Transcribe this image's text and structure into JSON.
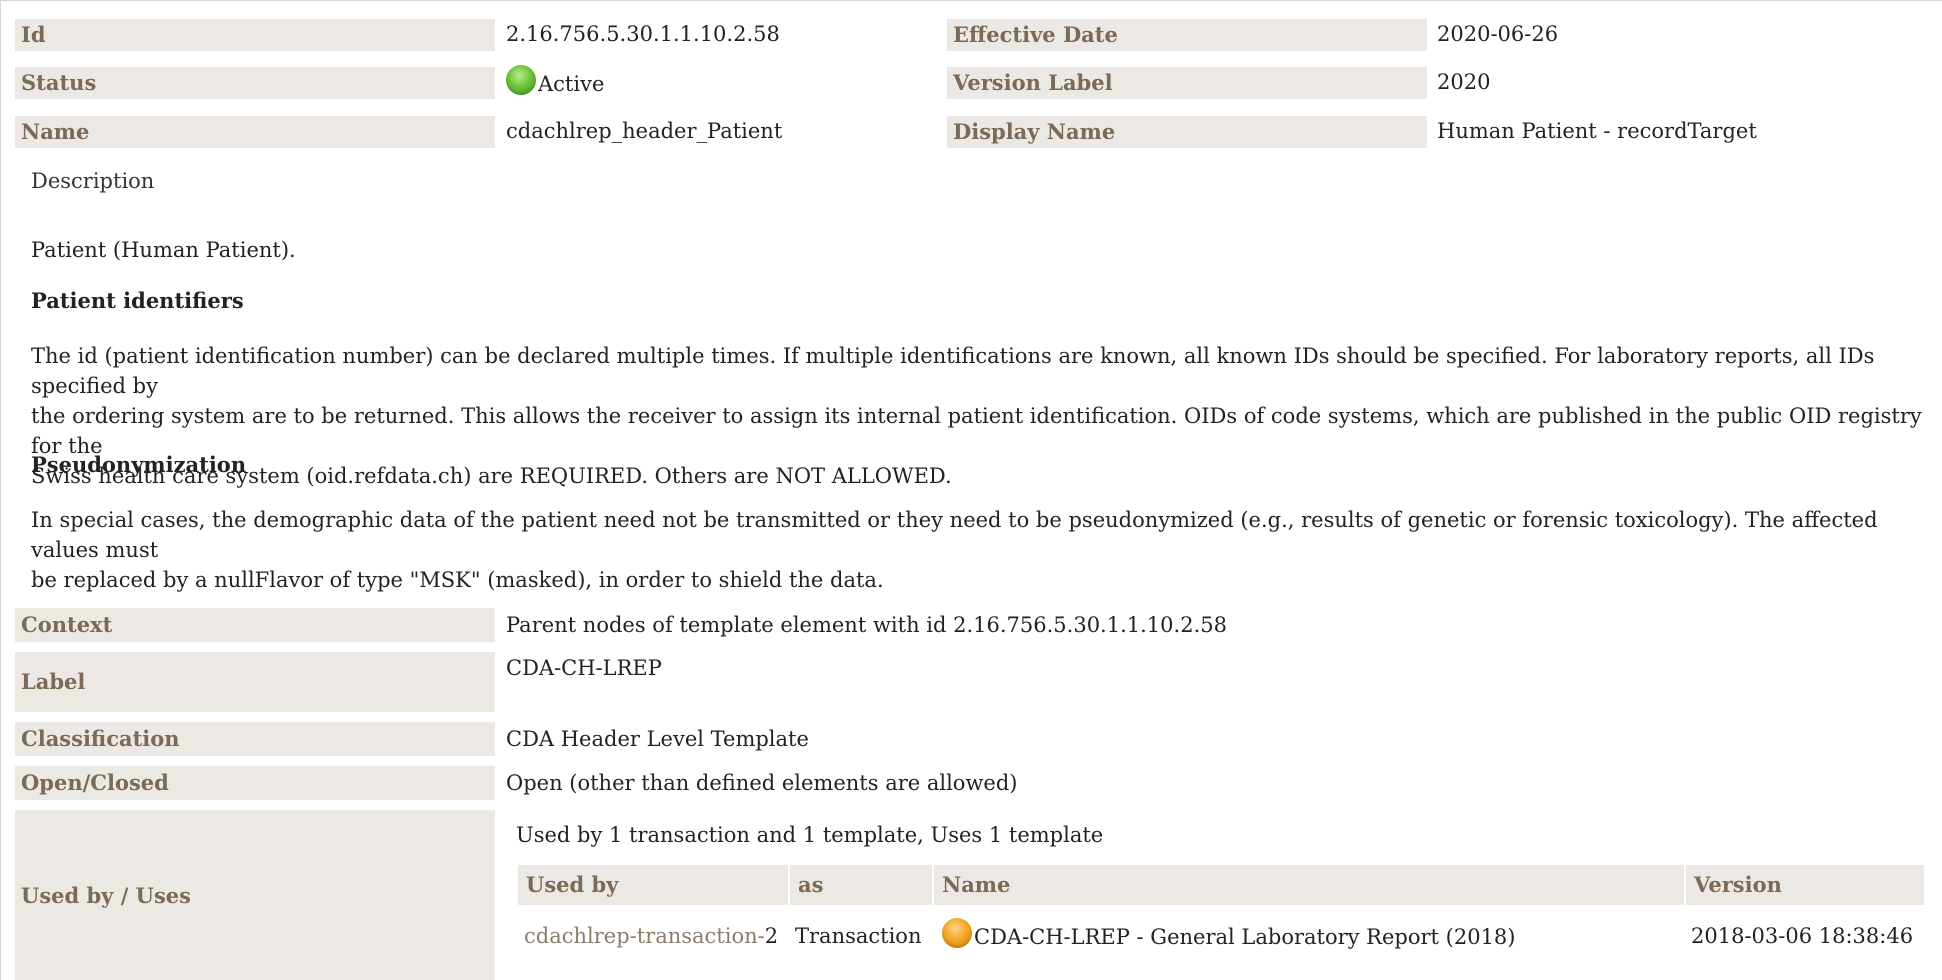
{
  "header": {
    "id_label": "Id",
    "id_value": "2.16.756.5.30.1.1.10.2.58",
    "effective_date_label": "Effective Date",
    "effective_date_value": "2020-06-26",
    "status_label": "Status",
    "status_value": "Active",
    "version_label_label": "Version Label",
    "version_label_value": "2020",
    "name_label": "Name",
    "name_value": "cdachlrep_header_Patient",
    "display_name_label": "Display Name",
    "display_name_value": "Human Patient - recordTarget"
  },
  "description": {
    "heading": "Description",
    "intro": "Patient (Human Patient).",
    "section1_title": "Patient identifiers",
    "section1_line1": "The id (patient identification number) can be declared multiple times. If multiple identifications are known, all known IDs should be specified. For laboratory reports, all IDs specified by",
    "section1_line2": "the ordering system are to be returned. This allows the receiver to assign its internal patient identification. OIDs of code systems, which are published in the public OID registry for the",
    "section1_line3": "Swiss health care system (oid.refdata.ch) are REQUIRED. Others are NOT ALLOWED.",
    "section2_title": "Pseudonymization",
    "section2_line1": "In special cases, the demographic data of the patient need not be transmitted or they need to be pseudonymized (e.g., results of genetic or forensic toxicology). The affected values must",
    "section2_line2": "be replaced by a nullFlavor of type \"MSK\" (masked), in order to shield the data."
  },
  "details": {
    "context_label": "Context",
    "context_value": "Parent nodes of template element with id 2.16.756.5.30.1.1.10.2.58",
    "label_label": "Label",
    "label_value": "CDA-CH-LREP",
    "classification_label": "Classification",
    "classification_value": "CDA Header Level Template",
    "open_closed_label": "Open/Closed",
    "open_closed_value": "Open (other than defined elements are allowed)",
    "used_by_label": "Used by / Uses",
    "used_by_summary": "Used by 1 transaction and 1 template, Uses 1 template"
  },
  "usage_table": {
    "columns": [
      "Used by",
      "as",
      "Name",
      "Version"
    ],
    "rows": [
      {
        "used_by_link": "cdachlrep-transaction-",
        "used_by_suffix": "2",
        "as": "Transaction",
        "name": "CDA-CH-LREP - General Laboratory Report (2018)",
        "version": "2018-03-06 18:38:46"
      }
    ]
  },
  "colors": {
    "label_bg": "#ece9e4",
    "label_text": "#7a6a57",
    "active_status": "#6cc33a",
    "pending_status": "#f5a623"
  },
  "icons": {
    "status": "green-circle-icon",
    "transaction_status": "orange-circle-icon"
  }
}
